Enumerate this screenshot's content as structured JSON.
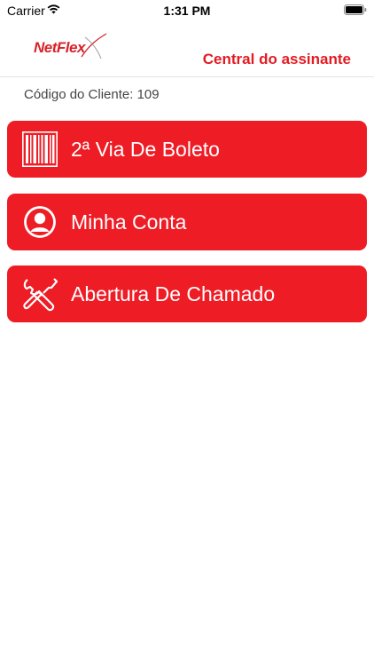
{
  "status_bar": {
    "carrier": "Carrier",
    "time": "1:31 PM"
  },
  "header": {
    "logo_text": "NetFlex",
    "title": "Central do assinante"
  },
  "client": {
    "label": "Código do Cliente: 109"
  },
  "menu": [
    {
      "label": "2ª Via De Boleto",
      "icon": "barcode-icon"
    },
    {
      "label": "Minha Conta",
      "icon": "user-circle-icon"
    },
    {
      "label": "Abertura De Chamado",
      "icon": "tools-icon"
    }
  ],
  "colors": {
    "accent": "#ee1c25",
    "title": "#e31b23",
    "text": "#444444"
  }
}
